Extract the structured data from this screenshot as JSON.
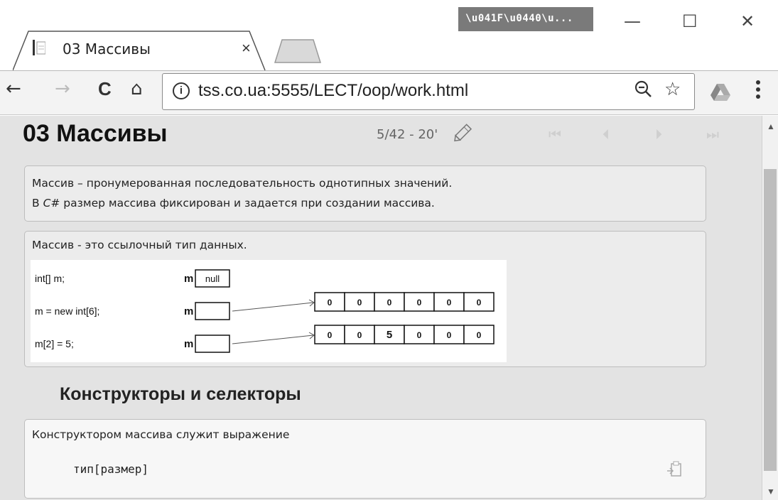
{
  "window": {
    "profile_badge": "\\u041F\\u0440\\u...",
    "minimize": "—",
    "maximize": "☐",
    "close": "✕"
  },
  "tab": {
    "title": "03 Массивы",
    "close": "×"
  },
  "toolbar": {
    "back": "←",
    "forward": "→",
    "reload": "C",
    "home": "⌂",
    "url": "tss.co.ua:5555/LECT/oop/work.html",
    "menu": "⋮"
  },
  "page": {
    "title": "03 Массивы",
    "counter": "5/42 - 20'",
    "pager": {
      "first": "⏮",
      "prev": "⏴",
      "next": "⏵",
      "last": "⏭"
    }
  },
  "card1": {
    "line1": "Массив – пронумерованная последовательность однотипных значений.",
    "line2_prefix": "В ",
    "line2_lang": "C#",
    "line2_rest": " размер массива фиксирован и задается при создании массива."
  },
  "card2": {
    "intro": "Массив - это ссылочный тип данных.",
    "diagram": {
      "rows": [
        {
          "code": "int[] m;",
          "var": "m",
          "cell": "null"
        },
        {
          "code": "m = new int[6];",
          "var": "m",
          "cell": "",
          "array": [
            "0",
            "0",
            "0",
            "0",
            "0",
            "0"
          ]
        },
        {
          "code": "m[2] = 5;",
          "var": "m",
          "cell": "",
          "array": [
            "0",
            "0",
            "5",
            "0",
            "0",
            "0"
          ]
        }
      ]
    }
  },
  "section": {
    "heading": "Конструкторы и селекторы"
  },
  "card3": {
    "text": "Конструктором массива служит выражение",
    "code": "тип[размер]"
  },
  "icons": {
    "favicon": "document-icon",
    "pin": "pencil-icon",
    "copy": "clipboard-icon",
    "extension": "google-drive-icon",
    "zoom": "zoom-out-icon",
    "bookmark": "star-icon"
  }
}
